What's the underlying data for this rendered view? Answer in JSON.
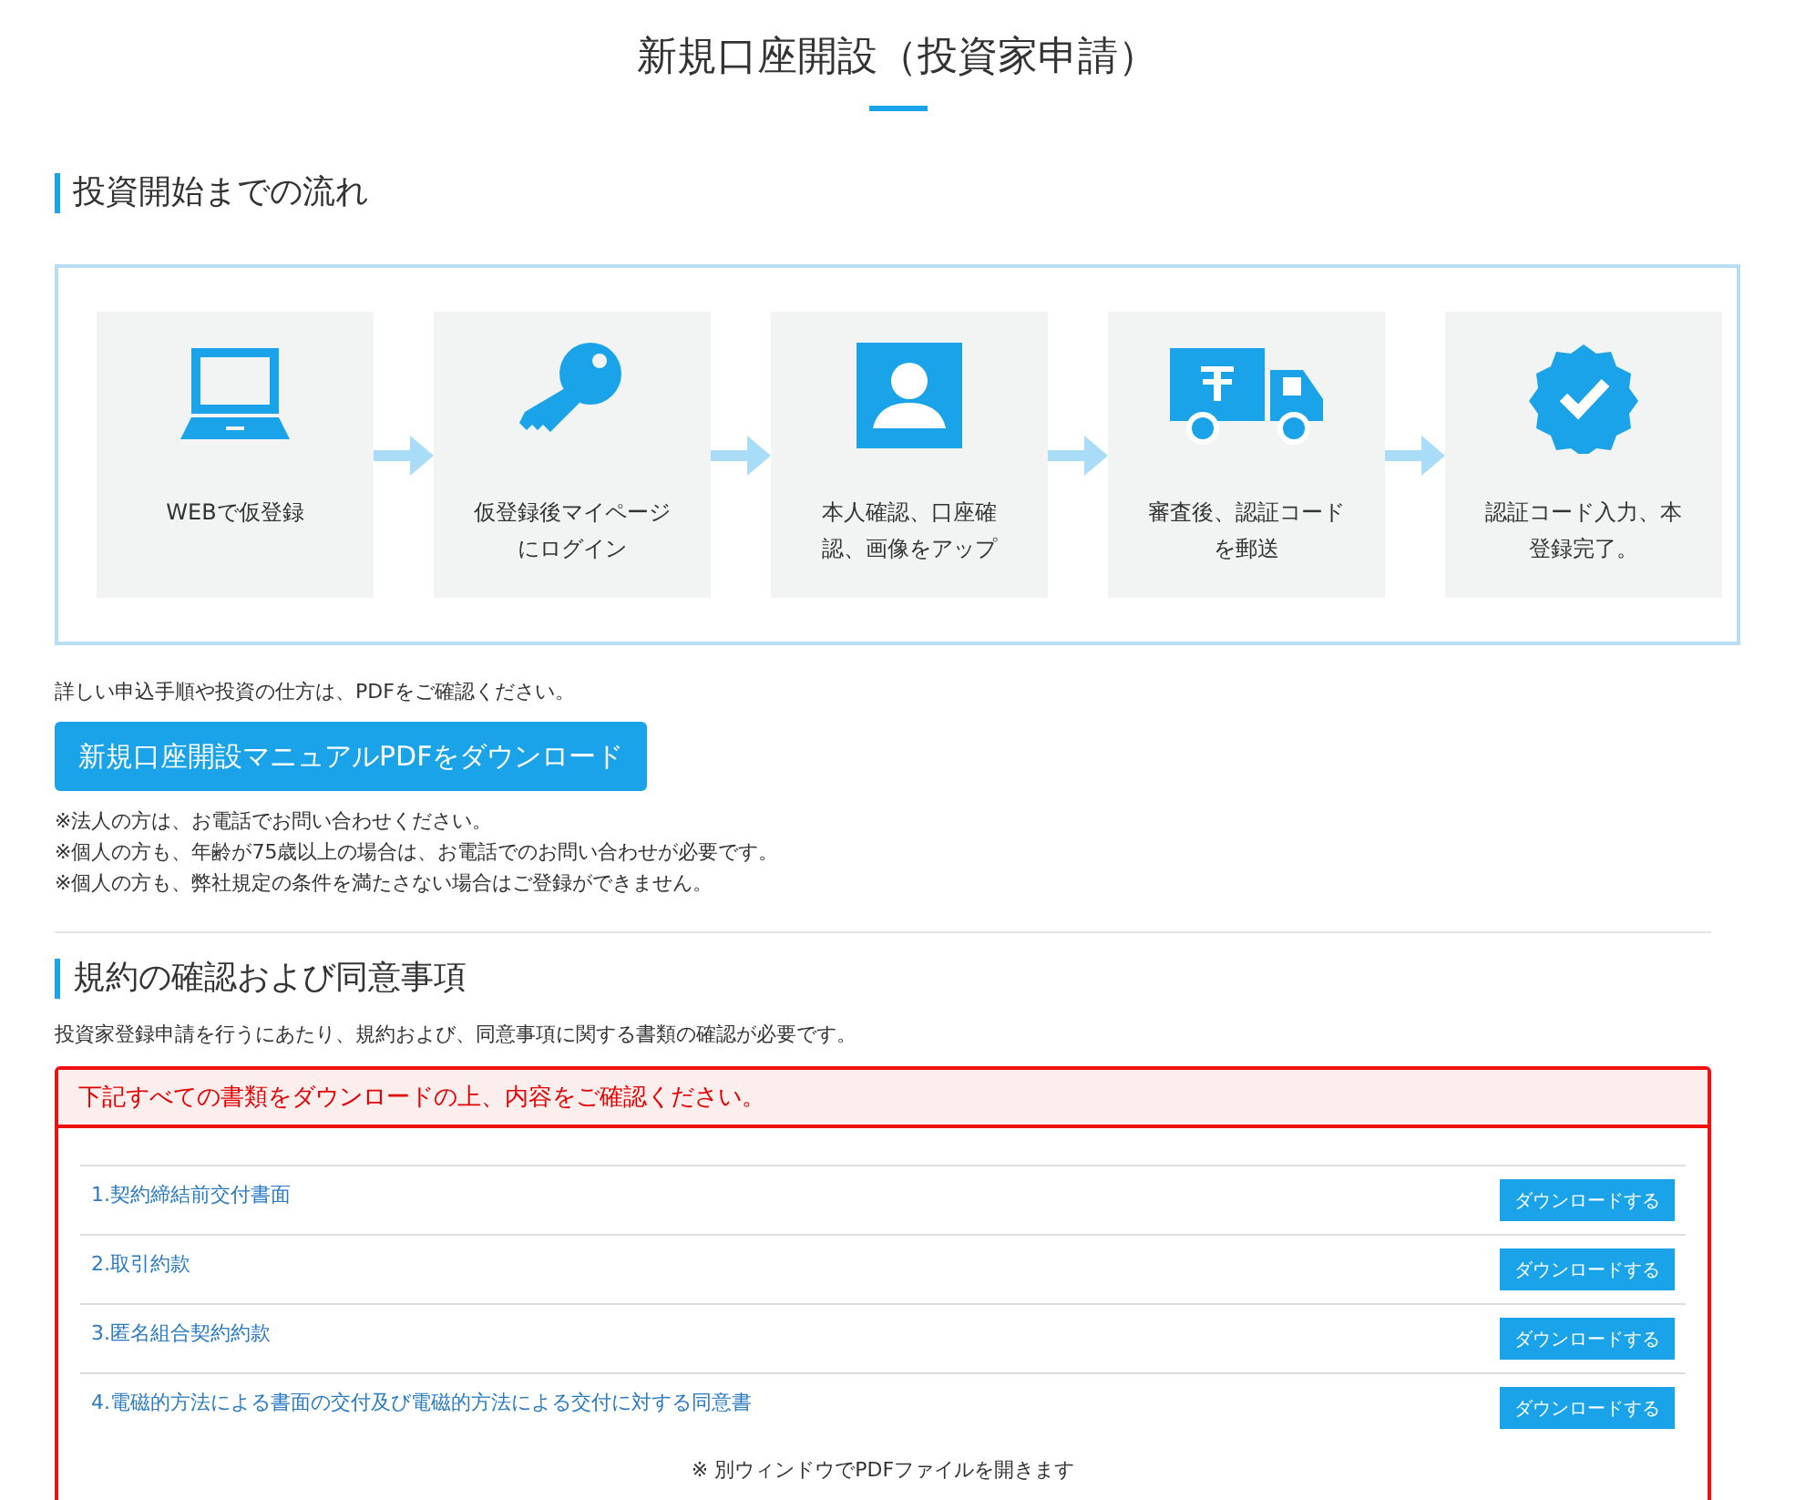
{
  "page_title": "新規口座開設（投資家申請）",
  "flow_section": {
    "heading": "投資開始までの流れ",
    "steps": [
      {
        "kind": "laptop",
        "label": "WEBで仮登録"
      },
      {
        "kind": "key",
        "label": "仮登録後マイページにログイン"
      },
      {
        "kind": "person",
        "label": "本人確認、口座確認、画像をアップ"
      },
      {
        "kind": "truck",
        "label": "審査後、認証コードを郵送"
      },
      {
        "kind": "badge",
        "label": "認証コード入力、本登録完了。"
      }
    ],
    "pdf_note": "詳しい申込手順や投資の仕方は、PDFをご確認ください。",
    "download_button": "新規口座開設マニュアルPDFをダウンロード",
    "notes": [
      "※法人の方は、お電話でお問い合わせください。",
      "※個人の方も、年齢が75歳以上の場合は、お電話でのお問い合わせが必要です。",
      "※個人の方も、弊社規定の条件を満たさない場合はご登録ができません。"
    ]
  },
  "terms_section": {
    "heading": "規約の確認および同意事項",
    "intro": "投資家登録申請を行うにあたり、規約および、同意事項に関する書類の確認が必要です。",
    "alert": "下記すべての書類をダウンロードの上、内容をご確認ください。",
    "documents": [
      {
        "title": "1.契約締結前交付書面",
        "button": "ダウンロードする"
      },
      {
        "title": "2.取引約款",
        "button": "ダウンロードする"
      },
      {
        "title": "3.匿名組合契約約款",
        "button": "ダウンロードする"
      },
      {
        "title": "4.電磁的方法による書面の交付及び電磁的方法による交付に対する同意書",
        "button": "ダウンロードする"
      }
    ],
    "footnote": "※ 別ウィンドウでPDFファイルを開きます"
  }
}
